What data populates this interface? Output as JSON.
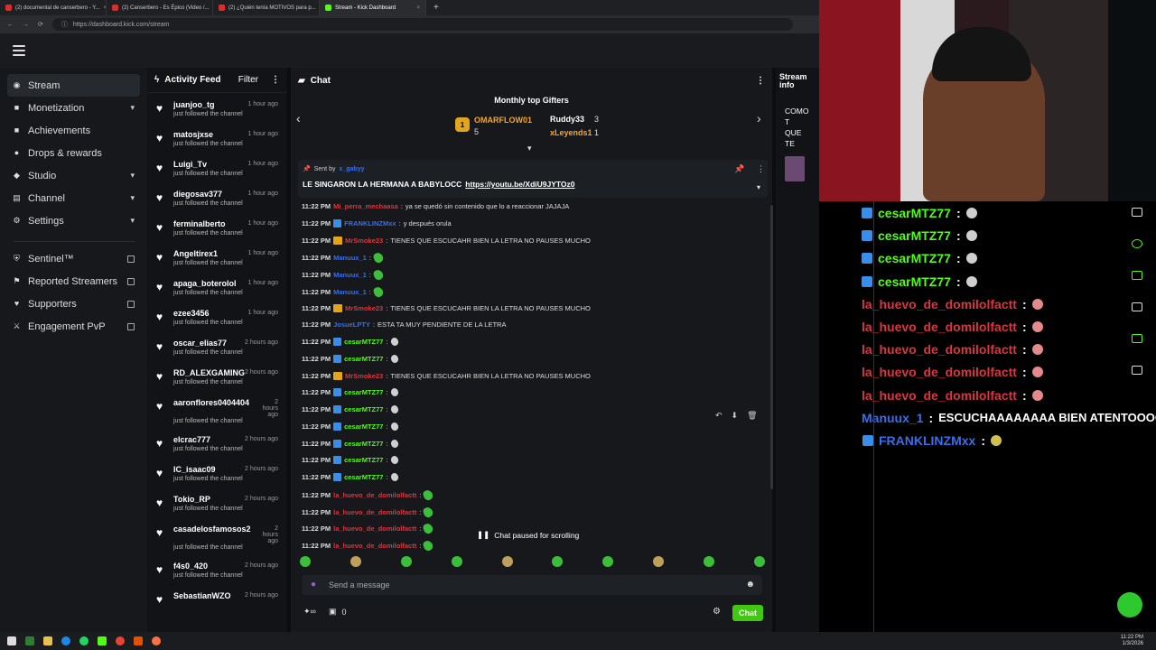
{
  "browser": {
    "tabs": [
      {
        "label": "(2) documental de canserbero - Y...",
        "color": "#e02b2b"
      },
      {
        "label": "(2) Canserbero - Es Épico (Video /...",
        "color": "#e02b2b"
      },
      {
        "label": "(2) ¿Quién tenía MOTIVOS para p...",
        "color": "#e02b2b"
      },
      {
        "label": "Stream - Kick Dashboard",
        "color": "#53fc18"
      }
    ],
    "url": "https://dashboard.kick.com/stream"
  },
  "sidebar": {
    "items": [
      {
        "label": "Stream",
        "icon": "broadcast-icon",
        "chevron": false
      },
      {
        "label": "Monetization",
        "icon": "money-icon",
        "chevron": true
      },
      {
        "label": "Achievements",
        "icon": "trophy-icon",
        "chevron": false
      },
      {
        "label": "Drops & rewards",
        "icon": "gift-icon",
        "chevron": false
      },
      {
        "label": "Studio",
        "icon": "studio-icon",
        "chevron": true
      },
      {
        "label": "Channel",
        "icon": "channel-icon",
        "chevron": true
      },
      {
        "label": "Settings",
        "icon": "gear-icon",
        "chevron": true
      }
    ],
    "external": [
      {
        "label": "Sentinel™",
        "icon": "shield-icon"
      },
      {
        "label": "Reported Streamers",
        "icon": "flag-icon"
      },
      {
        "label": "Supporters",
        "icon": "heart-icon"
      },
      {
        "label": "Engagement PvP",
        "icon": "swords-icon"
      }
    ]
  },
  "feed": {
    "title": "Activity Feed",
    "filter": "Filter",
    "items": [
      {
        "name": "juanjoo_tg",
        "time": "1 hour ago",
        "sub": "just followed the channel"
      },
      {
        "name": "matosjxse",
        "time": "1 hour ago",
        "sub": "just followed the channel"
      },
      {
        "name": "Luigi_Tv",
        "time": "1 hour ago",
        "sub": "just followed the channel"
      },
      {
        "name": "diegosav377",
        "time": "1 hour ago",
        "sub": "just followed the channel"
      },
      {
        "name": "ferminalberto",
        "time": "1 hour ago",
        "sub": "just followed the channel"
      },
      {
        "name": "Angeltirex1",
        "time": "1 hour ago",
        "sub": "just followed the channel"
      },
      {
        "name": "apaga_boterolol",
        "time": "1 hour ago",
        "sub": "just followed the channel"
      },
      {
        "name": "ezee3456",
        "time": "1 hour ago",
        "sub": "just followed the channel"
      },
      {
        "name": "oscar_elias77",
        "time": "2 hours ago",
        "sub": "just followed the channel"
      },
      {
        "name": "RD_ALEXGAMING",
        "time": "2 hours ago",
        "sub": "just followed the channel"
      },
      {
        "name": "aaronflores0404404",
        "time": "2 hours ago",
        "sub": "just followed the channel"
      },
      {
        "name": "elcrac777",
        "time": "2 hours ago",
        "sub": "just followed the channel"
      },
      {
        "name": "IC_isaac09",
        "time": "2 hours ago",
        "sub": "just followed the channel"
      },
      {
        "name": "Tokio_RP",
        "time": "2 hours ago",
        "sub": "just followed the channel"
      },
      {
        "name": "casadelosfamosos2",
        "time": "2 hours ago",
        "sub": "just followed the channel"
      },
      {
        "name": "f4s0_420",
        "time": "2 hours ago",
        "sub": "just followed the channel"
      },
      {
        "name": "SebastianWZO",
        "time": "2 hours ago",
        "sub": ""
      }
    ]
  },
  "chat": {
    "title": "Chat",
    "gifters_title": "Monthly top Gifters",
    "gifters": [
      {
        "name": "OMARFLOW01",
        "count": "5",
        "color": "#f5a623"
      },
      {
        "name": "Ruddy33",
        "count": "3",
        "color": "#ffffff"
      },
      {
        "name": "xLeyends1",
        "count": "1",
        "color": "#f5a623"
      }
    ],
    "pinned": {
      "sent_by": "Sent by",
      "user": "x_gabyy",
      "text": "LE SINGARON LA HERMANA A BABYLOCC",
      "link": "https://youtu.be/XdiU9JYTOz0"
    },
    "messages": [
      {
        "time": "11:22 PM",
        "user": "Mi_perra_mechaasa",
        "color": "#d9363e",
        "text": "ya se quedó sin contenido que lo a reaccionar JAJAJA",
        "emotes": 0
      },
      {
        "time": "11:22 PM",
        "user": "FRANKLINZMxx",
        "color": "#3a6ee8",
        "text": "y después orula",
        "emotes": 0
      },
      {
        "time": "11:22 PM",
        "user": "MrSmoke23",
        "color": "#d9363e",
        "text": "TIENES QUE ESCUCAHR BIEN LA LETRA NO PAUSES MUCHO",
        "emotes": 0
      },
      {
        "time": "11:22 PM",
        "user": "Manuux_1",
        "color": "#3a6ee8",
        "text": "",
        "emotes": 1
      },
      {
        "time": "11:22 PM",
        "user": "Manuux_1",
        "color": "#3a6ee8",
        "text": "",
        "emotes": 1
      },
      {
        "time": "11:22 PM",
        "user": "Manuux_1",
        "color": "#3a6ee8",
        "text": "",
        "emotes": 1
      },
      {
        "time": "11:22 PM",
        "user": "MrSmoke23",
        "color": "#d9363e",
        "text": "TIENES QUE ESCUCAHR BIEN LA LETRA NO PAUSES MUCHO",
        "emotes": 0
      },
      {
        "time": "11:22 PM",
        "user": "JosueLPTY",
        "color": "#3a6ee8",
        "text": "ESTA TA MUY PENDIENTE DE LA LETRA",
        "emotes": 0
      },
      {
        "time": "11:22 PM",
        "user": "cesarMTZ77",
        "color": "#53fc18",
        "text": "",
        "emotes": 2
      },
      {
        "time": "11:22 PM",
        "user": "cesarMTZ77",
        "color": "#53fc18",
        "text": "",
        "emotes": 2
      },
      {
        "time": "11:22 PM",
        "user": "MrSmoke23",
        "color": "#d9363e",
        "text": "TIENES QUE ESCUCAHR BIEN LA LETRA NO PAUSES MUCHO",
        "emotes": 0
      },
      {
        "time": "11:22 PM",
        "user": "cesarMTZ77",
        "color": "#53fc18",
        "text": "",
        "emotes": 2
      },
      {
        "time": "11:22 PM",
        "user": "cesarMTZ77",
        "color": "#53fc18",
        "text": "",
        "emotes": 2
      },
      {
        "time": "11:22 PM",
        "user": "cesarMTZ77",
        "color": "#53fc18",
        "text": "",
        "emotes": 2
      },
      {
        "time": "11:22 PM",
        "user": "cesarMTZ77",
        "color": "#53fc18",
        "text": "",
        "emotes": 2
      },
      {
        "time": "11:22 PM",
        "user": "cesarMTZ77",
        "color": "#53fc18",
        "text": "",
        "emotes": 2
      },
      {
        "time": "11:22 PM",
        "user": "cesarMTZ77",
        "color": "#53fc18",
        "text": "",
        "emotes": 2
      },
      {
        "time": "11:22 PM",
        "user": "la_huevo_de_domilolfactt",
        "color": "#d9363e",
        "text": "",
        "emotes": 1
      },
      {
        "time": "11:22 PM",
        "user": "la_huevo_de_domilolfactt",
        "color": "#d9363e",
        "text": "",
        "emotes": 1
      },
      {
        "time": "11:22 PM",
        "user": "la_huevo_de_domilolfactt",
        "color": "#d9363e",
        "text": "",
        "emotes": 1
      },
      {
        "time": "11:22 PM",
        "user": "la_huevo_de_domilolfactt",
        "color": "#d9363e",
        "text": "",
        "emotes": 1
      }
    ],
    "paused": "Chat paused for scrolling",
    "input_placeholder": "Send a message",
    "gift_count": "0",
    "send": "Chat"
  },
  "stream_info": {
    "title": "Stream info",
    "text": "COMO T QUE TE"
  },
  "overlay": {
    "messages": [
      {
        "user": "cesarMTZ77",
        "color": "#53fc18",
        "text": ""
      },
      {
        "user": "cesarMTZ77",
        "color": "#53fc18",
        "text": ""
      },
      {
        "user": "cesarMTZ77",
        "color": "#53fc18",
        "text": ""
      },
      {
        "user": "cesarMTZ77",
        "color": "#53fc18",
        "text": ""
      },
      {
        "user": "la_huevo_de_domilolfactt",
        "color": "#d9363e",
        "text": ""
      },
      {
        "user": "la_huevo_de_domilolfactt",
        "color": "#d9363e",
        "text": ""
      },
      {
        "user": "la_huevo_de_domilolfactt",
        "color": "#d9363e",
        "text": ""
      },
      {
        "user": "la_huevo_de_domilolfactt",
        "color": "#d9363e",
        "text": ""
      },
      {
        "user": "la_huevo_de_domilolfactt",
        "color": "#d9363e",
        "text": ""
      },
      {
        "user": "Manuux_1",
        "color": "#3a6ee8",
        "text": "ESCUCHAAAAAAAA BIEN ATENTOOOOO"
      },
      {
        "user": "FRANKLINZMxx",
        "color": "#3a6ee8",
        "text": ""
      }
    ]
  },
  "taskbar": {
    "time": "11:22 PM",
    "date": "1/3/2026"
  },
  "colors": {
    "accent": "#53fc18"
  }
}
